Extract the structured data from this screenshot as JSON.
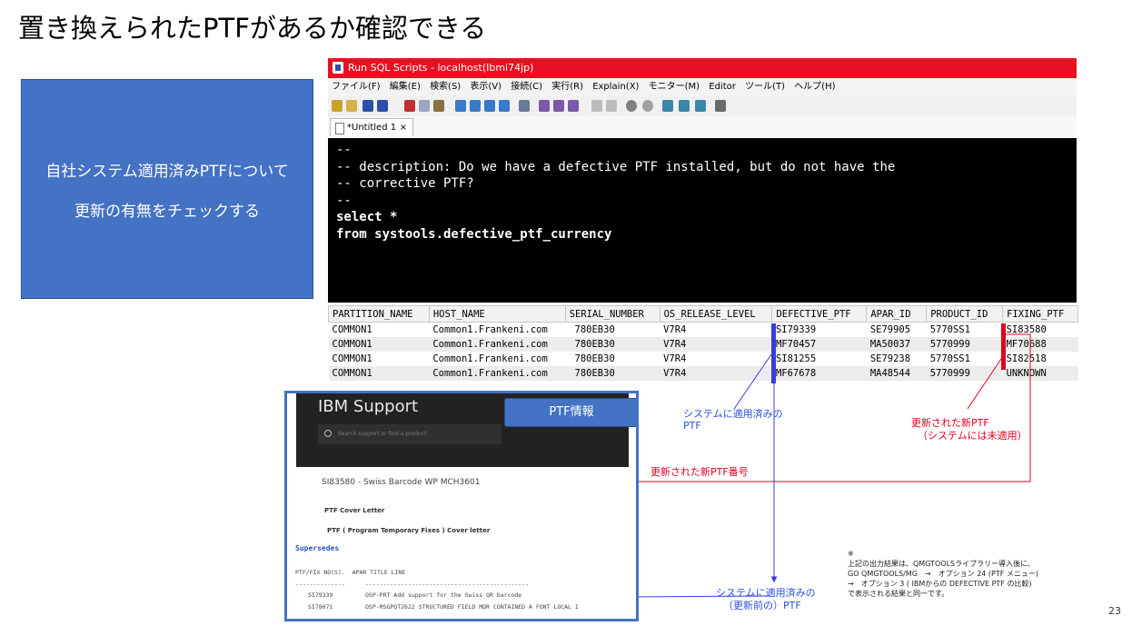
{
  "slide": {
    "title": "置き換えられたPTFがあるか確認できる",
    "box_line1": "自社システム適用済みPTFについて",
    "box_line2": "更新の有無をチェックする",
    "page_number": "23"
  },
  "window": {
    "title": "Run SQL Scripts - localhost(Ibmi74jp)",
    "menu": [
      "ファイル(F)",
      "編集(E)",
      "検索(S)",
      "表示(V)",
      "接続(C)",
      "実行(R)",
      "Explain(X)",
      "モニター(M)",
      "Editor",
      "ツール(T)",
      "ヘルプ(H)"
    ],
    "tab_label": "*Untitled 1",
    "tab_close": "×"
  },
  "editor": {
    "lines": [
      "--",
      "-- description: Do we have a defective PTF installed, but do not have the",
      "-- corrective PTF?",
      "--",
      "select *",
      "from systools.defective_ptf_currency"
    ]
  },
  "results": {
    "columns": [
      "PARTITION_NAME",
      "HOST_NAME",
      "SERIAL_NUMBER",
      "OS_RELEASE_LEVEL",
      "DEFECTIVE_PTF",
      "APAR_ID",
      "PRODUCT_ID",
      "FIXING_PTF"
    ],
    "rows": [
      [
        "COMMON1",
        "Common1.Frankeni.com",
        " 780EB30",
        "V7R4",
        "SI79339",
        "SE79905",
        "5770SS1",
        "SI83580"
      ],
      [
        "COMMON1",
        "Common1.Frankeni.com",
        " 780EB30",
        "V7R4",
        "MF70457",
        "MA50037",
        "5770999",
        "MF70688"
      ],
      [
        "COMMON1",
        "Common1.Frankeni.com",
        " 780EB30",
        "V7R4",
        "SI81255",
        "SE79238",
        "5770SS1",
        "SI82518"
      ],
      [
        "COMMON1",
        "Common1.Frankeni.com",
        " 780EB30",
        "V7R4",
        "MF67678",
        "MA48544",
        "5770999",
        "UNKNOWN"
      ]
    ]
  },
  "ibm": {
    "brand": "IBM Support",
    "search_placeholder": "Search support or find a product",
    "ptf_button": "PTF情報",
    "doc_title": "SI83580 - Swiss Barcode WP MCH3601",
    "cover_letter": "PTF Cover Letter",
    "cover_letter2": "PTF ( Program Temporary Fixes ) Cover letter",
    "supersedes": "Supersedes",
    "table_header": "PTF/FIX NO(S).  APAR TITLE LINE",
    "dash_left": "--------------",
    "dash_right": "----------------------------------------------",
    "row1_ptf": "SI79339",
    "row1_text": "OSP-PRT Add support for the Swiss QR barcode",
    "row2_ptf": "SI78071",
    "row2_text": "OSP-MSGPQT2622 STRUCTURED FIELD MDR CONTAINED A FONT LOCAL I"
  },
  "callouts": {
    "applied_1": "システムに適用済みの",
    "applied_2": "PTF",
    "new_1": "更新された新PTF",
    "new_2": "（システムには未適用）",
    "new_number": "更新された新PTF番号",
    "prior_1": "システムに適用済みの",
    "prior_2": "（更新前の）PTF"
  },
  "note": {
    "mark": "※",
    "line1": "上記の出力結果は、QMGTOOLSライブラリー導入後に、",
    "line2": "GO QMGTOOLS/MG　→　オプション 24 (PTF メニュー)",
    "line3": "→　オプション 3 ( IBMからの DEFECTIVE PTF の比較)",
    "line4": "で表示される結果と同一です。"
  },
  "colors": {
    "accent_blue": "#4472c4",
    "title_bar_red": "#e81123",
    "marker_red": "#e0001c",
    "marker_blue": "#3b3bdc"
  }
}
